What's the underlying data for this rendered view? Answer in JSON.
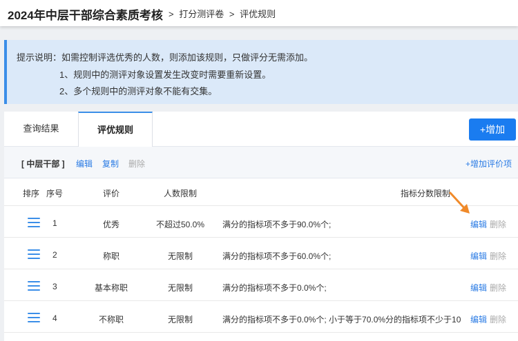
{
  "header": {
    "title": "2024年中层干部综合素质考核",
    "breadcrumb": [
      ">",
      "打分测评卷",
      ">",
      "评优规则"
    ]
  },
  "notice": {
    "line1": "提示说明：如需控制评选优秀的人数，则添加该规则，只做评分无需添加。",
    "line2": "1、规则中的测评对象设置发生改变时需要重新设置。",
    "line3": "2、多个规则中的测评对象不能有交集。"
  },
  "tabs": [
    {
      "label": "查询结果"
    },
    {
      "label": "评优规则"
    }
  ],
  "add_button": "+增加",
  "rule": {
    "name": "[ 中层干部 ]",
    "edit": "编辑",
    "copy": "复制",
    "delete": "删除",
    "add_eval": "+增加评价项"
  },
  "table": {
    "columns": [
      "排序",
      "序号",
      "评价",
      "人数限制",
      "指标分数限制"
    ],
    "rows": [
      {
        "no": "1",
        "eval": "优秀",
        "limit": "不超过50.0%",
        "score_limit": "满分的指标项不多于90.0%个;",
        "edit": "编辑",
        "delete": "删除"
      },
      {
        "no": "2",
        "eval": "称职",
        "limit": "无限制",
        "score_limit": "满分的指标项不多于60.0%个;",
        "edit": "编辑",
        "delete": "删除"
      },
      {
        "no": "3",
        "eval": "基本称职",
        "limit": "无限制",
        "score_limit": "满分的指标项不多于0.0%个;",
        "edit": "编辑",
        "delete": "删除"
      },
      {
        "no": "4",
        "eval": "不称职",
        "limit": "无限制",
        "score_limit": "满分的指标项不多于0.0%个;  小于等于70.0%分的指标项不少于10",
        "edit": "编辑",
        "delete": "删除"
      }
    ]
  },
  "colors": {
    "accent": "#1a7cf0",
    "link": "#2a7be4",
    "notice_bg": "#dbe9f9",
    "arrow": "#f08a2a"
  },
  "icons": [
    "drag-handle-icon",
    "orange-arrow-icon"
  ]
}
